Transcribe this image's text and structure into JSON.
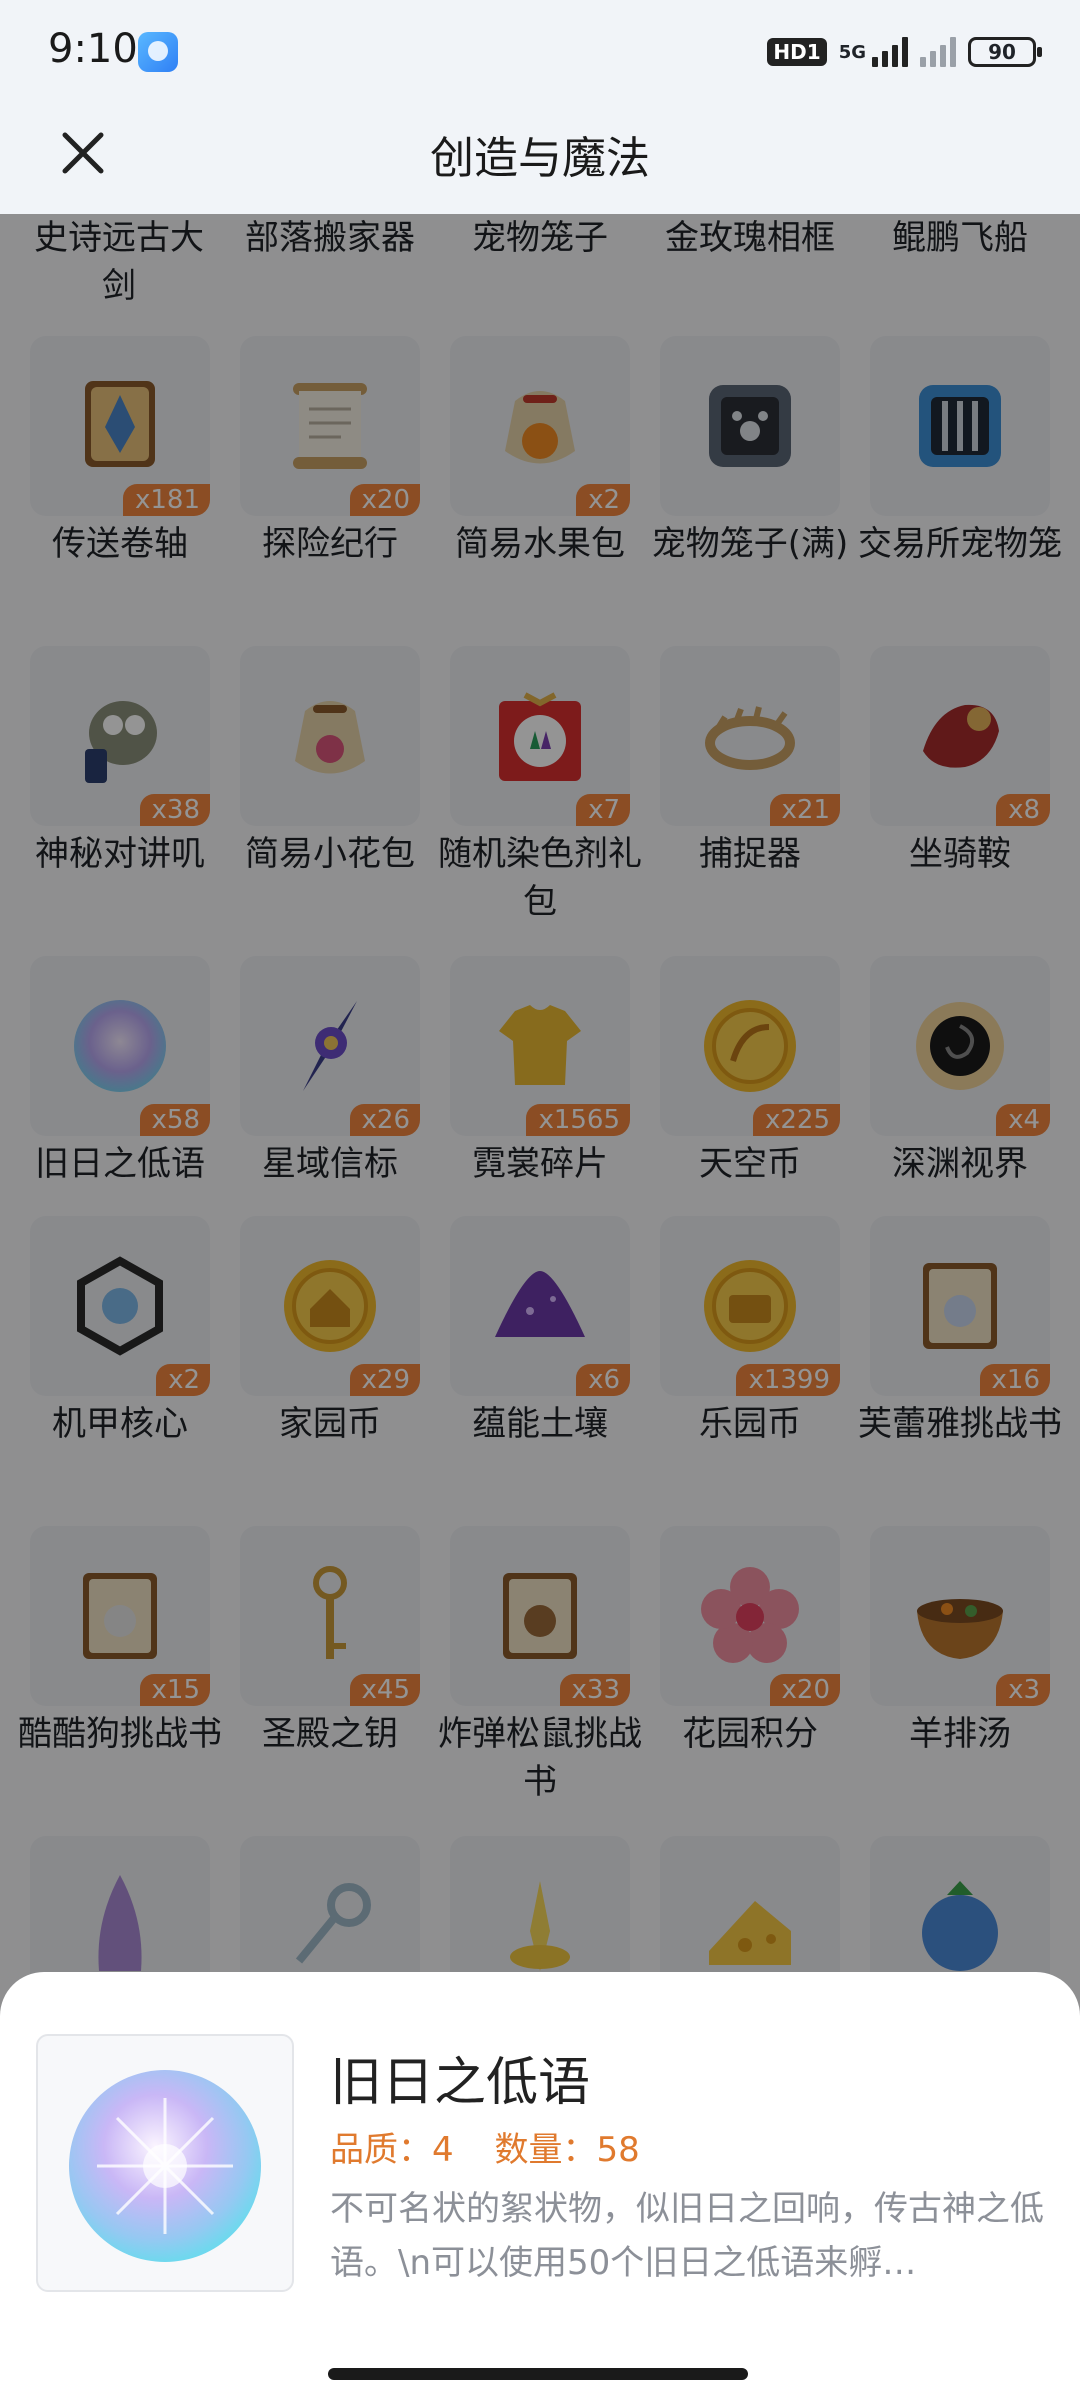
{
  "status_bar": {
    "time": "9:10",
    "hd_label": "HD1",
    "network": "5G",
    "battery": "90"
  },
  "header": {
    "title": "创造与魔法"
  },
  "partial_row": [
    "史诗远古大剑",
    "部落搬家器",
    "宠物笼子",
    "金玫瑰相框",
    "鲲鹏飞船"
  ],
  "items": [
    {
      "name": "传送卷轴",
      "qty": "x181",
      "icon": "scroll-icon"
    },
    {
      "name": "探险纪行",
      "qty": "x20",
      "icon": "paper-scroll-icon"
    },
    {
      "name": "简易水果包",
      "qty": "x2",
      "icon": "fruit-bag-icon"
    },
    {
      "name": "宠物笼子(满)",
      "qty": "",
      "icon": "pet-cage-icon"
    },
    {
      "name": "交易所宠物笼",
      "qty": "",
      "icon": "exchange-cage-icon"
    },
    {
      "name": "神秘对讲叽",
      "qty": "x38",
      "icon": "walkie-bird-icon"
    },
    {
      "name": "简易小花包",
      "qty": "",
      "icon": "flower-bag-icon"
    },
    {
      "name": "随机染色剂礼包",
      "qty": "x7",
      "icon": "dye-gift-icon"
    },
    {
      "name": "捕捉器",
      "qty": "x21",
      "icon": "trap-icon"
    },
    {
      "name": "坐骑鞍",
      "qty": "x8",
      "icon": "saddle-icon"
    },
    {
      "name": "旧日之低语",
      "qty": "x58",
      "icon": "whisper-orb-icon"
    },
    {
      "name": "星域信标",
      "qty": "x26",
      "icon": "star-beacon-icon"
    },
    {
      "name": "霓裳碎片",
      "qty": "x1565",
      "icon": "shirt-icon"
    },
    {
      "name": "天空币",
      "qty": "x225",
      "icon": "sky-coin-icon"
    },
    {
      "name": "深渊视界",
      "qty": "x4",
      "icon": "abyss-eye-icon"
    },
    {
      "name": "机甲核心",
      "qty": "x2",
      "icon": "mech-core-icon"
    },
    {
      "name": "家园币",
      "qty": "x29",
      "icon": "home-coin-icon"
    },
    {
      "name": "蕴能土壤",
      "qty": "x6",
      "icon": "soil-pile-icon"
    },
    {
      "name": "乐园币",
      "qty": "x1399",
      "icon": "park-coin-icon"
    },
    {
      "name": "芙蕾雅挑战书",
      "qty": "x16",
      "icon": "wanted-scroll-icon"
    },
    {
      "name": "酷酷狗挑战书",
      "qty": "x15",
      "icon": "wanted-scroll-icon"
    },
    {
      "name": "圣殿之钥",
      "qty": "x45",
      "icon": "key-icon"
    },
    {
      "name": "炸弹松鼠挑战书",
      "qty": "x33",
      "icon": "wanted-scroll-icon"
    },
    {
      "name": "花园积分",
      "qty": "x20",
      "icon": "flower-badge-icon"
    },
    {
      "name": "羊排汤",
      "qty": "x3",
      "icon": "soup-bowl-icon"
    },
    {
      "name": "",
      "qty": "",
      "icon": "purple-crystal-icon"
    },
    {
      "name": "",
      "qty": "",
      "icon": "silver-key-icon"
    },
    {
      "name": "",
      "qty": "",
      "icon": "golden-light-icon"
    },
    {
      "name": "",
      "qty": "",
      "icon": "cheese-icon"
    },
    {
      "name": "",
      "qty": "",
      "icon": "blue-fruit-icon"
    }
  ],
  "detail": {
    "title": "旧日之低语",
    "quality": "品质：4",
    "quantity": "数量：58",
    "description": "不可名状的絮状物，似旧日之回响，传古神之低语。\\n可以使用50个旧日之低语来孵…"
  }
}
